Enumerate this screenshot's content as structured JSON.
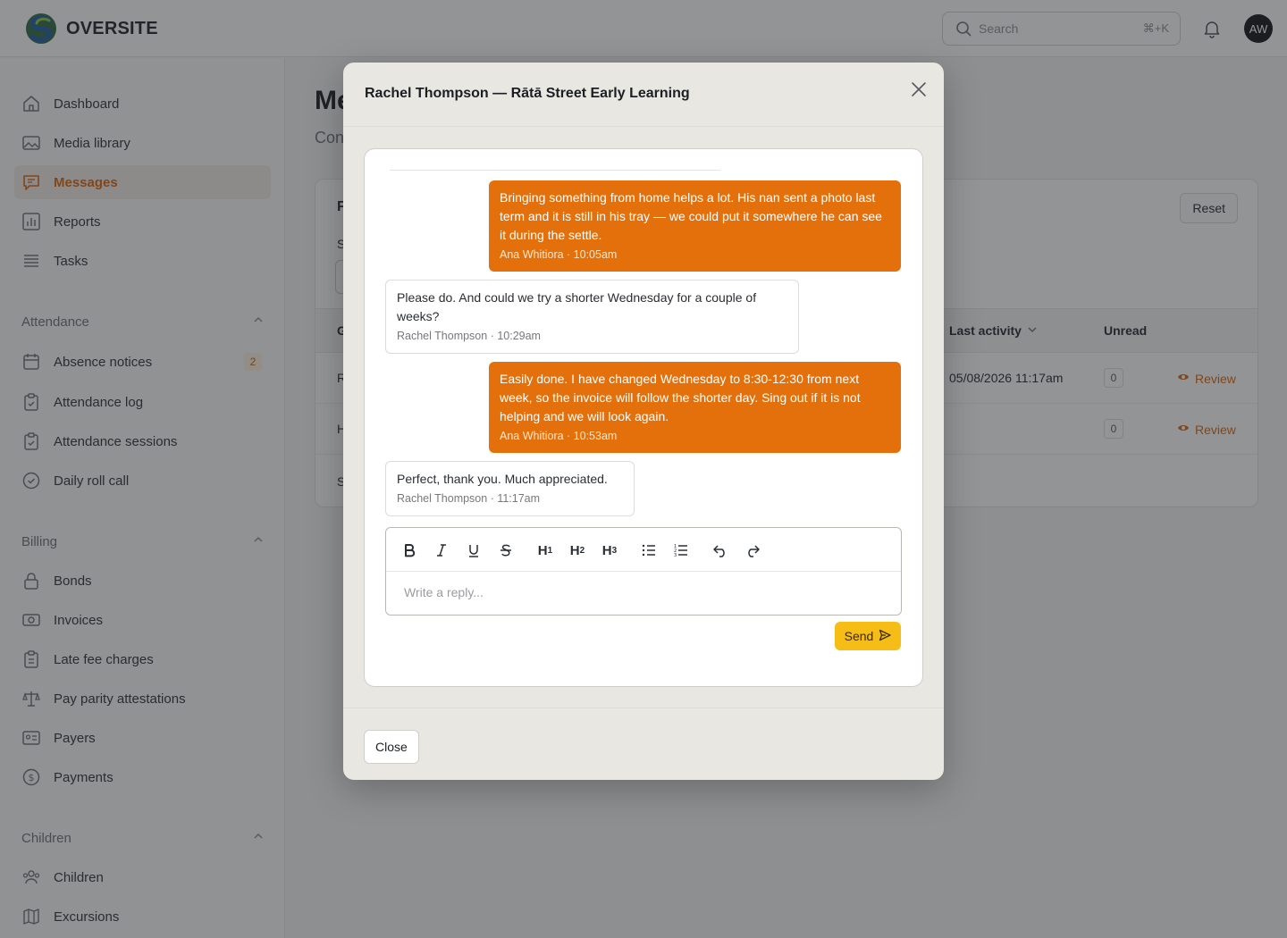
{
  "app": {
    "brand": "OVERSITE"
  },
  "topbar": {
    "search_placeholder": "Search",
    "search_shortcut": "⌘+K",
    "avatar_initials": "AW"
  },
  "sidebar": {
    "main": [
      {
        "label": "Dashboard",
        "icon": "home-icon"
      },
      {
        "label": "Media library",
        "icon": "image-icon"
      },
      {
        "label": "Messages",
        "icon": "chat-icon",
        "active": true
      },
      {
        "label": "Reports",
        "icon": "bar-chart-icon"
      },
      {
        "label": "Tasks",
        "icon": "list-icon"
      }
    ],
    "attendance": {
      "title": "Attendance",
      "items": [
        {
          "label": "Absence notices",
          "icon": "calendar-icon",
          "badge": "2"
        },
        {
          "label": "Attendance log",
          "icon": "clipboard-check-icon"
        },
        {
          "label": "Attendance sessions",
          "icon": "clipboard-check-icon"
        },
        {
          "label": "Daily roll call",
          "icon": "check-circle-icon"
        }
      ]
    },
    "billing": {
      "title": "Billing",
      "items": [
        {
          "label": "Bonds",
          "icon": "lock-icon"
        },
        {
          "label": "Invoices",
          "icon": "banknote-icon"
        },
        {
          "label": "Late fee charges",
          "icon": "receipt-icon"
        },
        {
          "label": "Pay parity attestations",
          "icon": "scale-icon"
        },
        {
          "label": "Payers",
          "icon": "id-card-icon"
        },
        {
          "label": "Payments",
          "icon": "dollar-circle-icon"
        }
      ]
    },
    "children": {
      "title": "Children",
      "items": [
        {
          "label": "Children",
          "icon": "users-icon"
        },
        {
          "label": "Excursions",
          "icon": "map-icon"
        }
      ]
    }
  },
  "main": {
    "title_fragment": "Me",
    "subtitle_fragment": "Con",
    "card_heading_fragment": "F",
    "reset_label": "Reset",
    "filter_label_fragment": "S",
    "table": {
      "col_first_fragment": "G",
      "col_last_activity": "Last activity",
      "col_unread": "Unread",
      "rows": [
        {
          "first_fragment": "R",
          "last_activity": "05/08/2026 11:17am",
          "unread": "0",
          "action": "Review"
        },
        {
          "first_fragment": "H",
          "last_activity": "",
          "unread": "0",
          "action": "Review"
        }
      ],
      "footer_fragment": "S"
    }
  },
  "modal": {
    "title": "Rachel Thompson — Rātā Street Early Learning",
    "messages": [
      {
        "direction": "out",
        "text": "Bringing something from home helps a lot. His nan sent a photo last term and it is still in his tray — we could put it somewhere he can see it during the settle.",
        "meta": "Ana Whitiora · 10:05am"
      },
      {
        "direction": "in",
        "text": "Please do. And could we try a shorter Wednesday for a couple of weeks?",
        "meta": "Rachel Thompson · 10:29am"
      },
      {
        "direction": "out",
        "text": "Easily done. I have changed Wednesday to 8:30-12:30 from next week, so the invoice will follow the shorter day. Sing out if it is not helping and we will look again.",
        "meta": "Ana Whitiora · 10:53am"
      },
      {
        "direction": "in",
        "text": "Perfect, thank you. Much appreciated.",
        "meta": "Rachel Thompson · 11:17am"
      }
    ],
    "editor": {
      "placeholder": "Write a reply..."
    },
    "send_label": "Send",
    "close_label": "Close"
  },
  "colors": {
    "accent": "#e3700a",
    "send": "#f6bd16",
    "active_nav": "#d9650b"
  }
}
